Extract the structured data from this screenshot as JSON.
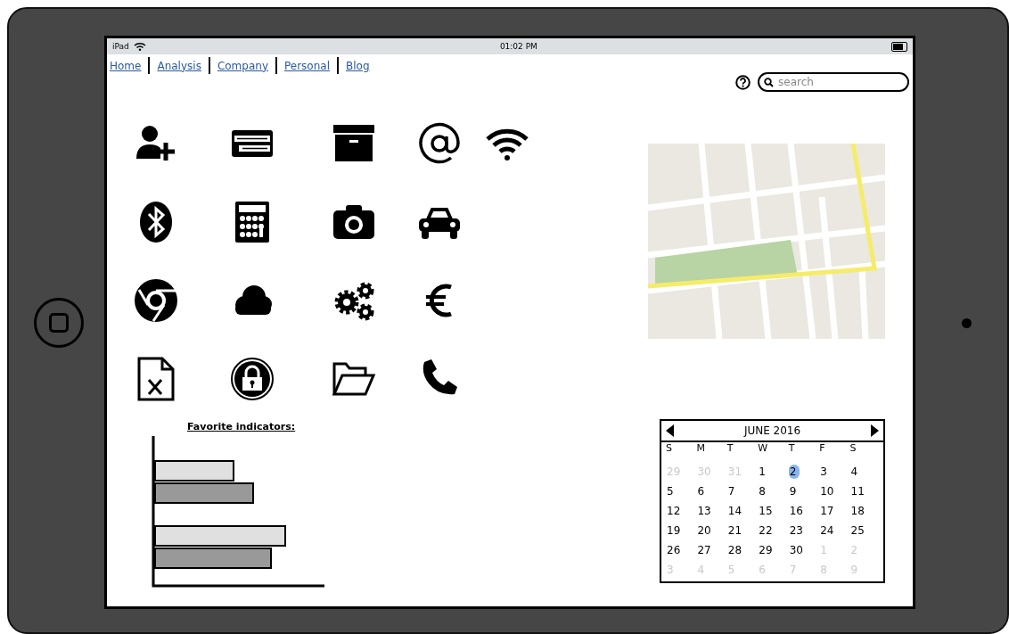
{
  "status_bar": {
    "device": "iPad",
    "time": "01:02 PM"
  },
  "nav": {
    "links": [
      {
        "label": "Home"
      },
      {
        "label": "Analysis"
      },
      {
        "label": "Company"
      },
      {
        "label": "Personal"
      },
      {
        "label": "Blog"
      }
    ]
  },
  "search": {
    "placeholder": "search"
  },
  "chart_title": "Favorite indicators:",
  "calendar": {
    "month": "JUNE 2016",
    "weekdays": [
      "S",
      "M",
      "T",
      "W",
      "T",
      "F",
      "S"
    ],
    "days": [
      {
        "label": "29",
        "kind": "other",
        "selected": false
      },
      {
        "label": "30",
        "kind": "other",
        "selected": false
      },
      {
        "label": "31",
        "kind": "other",
        "selected": false
      },
      {
        "label": "1",
        "kind": "current",
        "selected": false
      },
      {
        "label": "2",
        "kind": "current",
        "selected": true
      },
      {
        "label": "3",
        "kind": "current",
        "selected": false
      },
      {
        "label": "4",
        "kind": "current",
        "selected": false
      },
      {
        "label": "5",
        "kind": "current",
        "selected": false
      },
      {
        "label": "6",
        "kind": "current",
        "selected": false
      },
      {
        "label": "7",
        "kind": "current",
        "selected": false
      },
      {
        "label": "8",
        "kind": "current",
        "selected": false
      },
      {
        "label": "9",
        "kind": "current",
        "selected": false
      },
      {
        "label": "10",
        "kind": "current",
        "selected": false
      },
      {
        "label": "11",
        "kind": "current",
        "selected": false
      },
      {
        "label": "12",
        "kind": "current",
        "selected": false
      },
      {
        "label": "13",
        "kind": "current",
        "selected": false
      },
      {
        "label": "14",
        "kind": "current",
        "selected": false
      },
      {
        "label": "15",
        "kind": "current",
        "selected": false
      },
      {
        "label": "16",
        "kind": "current",
        "selected": false
      },
      {
        "label": "17",
        "kind": "current",
        "selected": false
      },
      {
        "label": "18",
        "kind": "current",
        "selected": false
      },
      {
        "label": "19",
        "kind": "current",
        "selected": false
      },
      {
        "label": "20",
        "kind": "current",
        "selected": false
      },
      {
        "label": "21",
        "kind": "current",
        "selected": false
      },
      {
        "label": "22",
        "kind": "current",
        "selected": false
      },
      {
        "label": "23",
        "kind": "current",
        "selected": false
      },
      {
        "label": "24",
        "kind": "current",
        "selected": false
      },
      {
        "label": "25",
        "kind": "current",
        "selected": false
      },
      {
        "label": "26",
        "kind": "current",
        "selected": false
      },
      {
        "label": "27",
        "kind": "current",
        "selected": false
      },
      {
        "label": "28",
        "kind": "current",
        "selected": false
      },
      {
        "label": "29",
        "kind": "current",
        "selected": false
      },
      {
        "label": "30",
        "kind": "current",
        "selected": false
      },
      {
        "label": "1",
        "kind": "other",
        "selected": false
      },
      {
        "label": "2",
        "kind": "other",
        "selected": false
      },
      {
        "label": "3",
        "kind": "other",
        "selected": false
      },
      {
        "label": "4",
        "kind": "other",
        "selected": false
      },
      {
        "label": "5",
        "kind": "other",
        "selected": false
      },
      {
        "label": "6",
        "kind": "other",
        "selected": false
      },
      {
        "label": "7",
        "kind": "other",
        "selected": false
      },
      {
        "label": "8",
        "kind": "other",
        "selected": false
      },
      {
        "label": "9",
        "kind": "other",
        "selected": false
      }
    ]
  }
}
